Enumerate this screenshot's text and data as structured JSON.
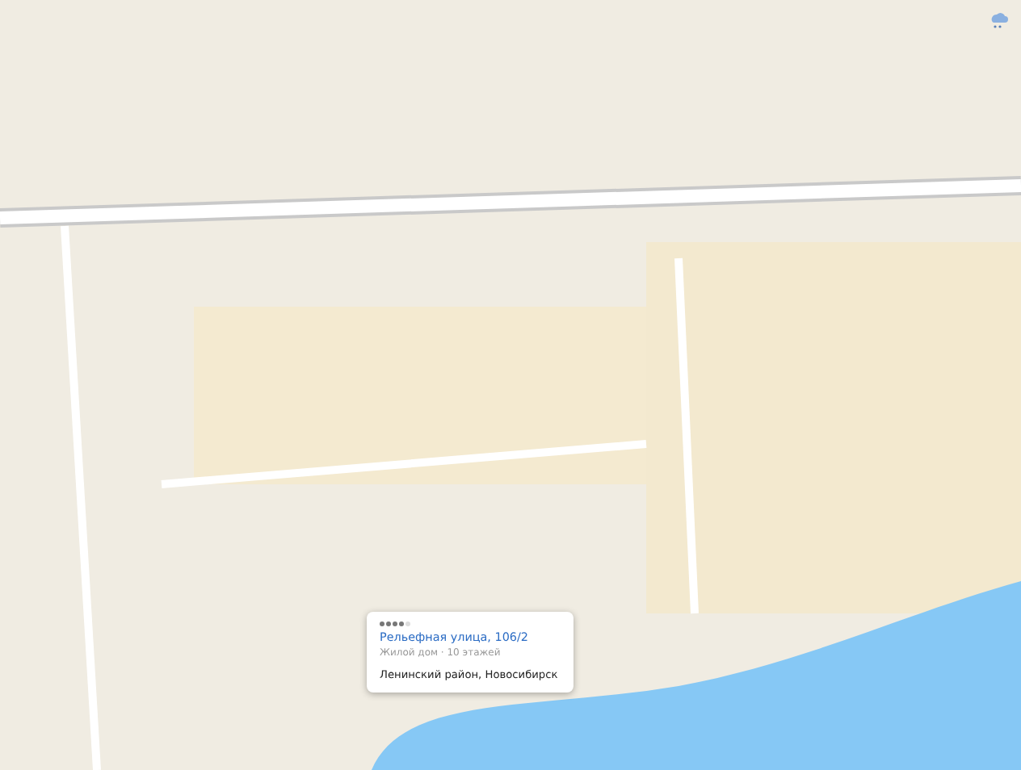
{
  "place_card": {
    "stars": 4,
    "address": "Рельефная улица, 106/2",
    "details": "Жилой дом · 10 этажей",
    "district": "Ленинский район, Новосибирск"
  }
}
